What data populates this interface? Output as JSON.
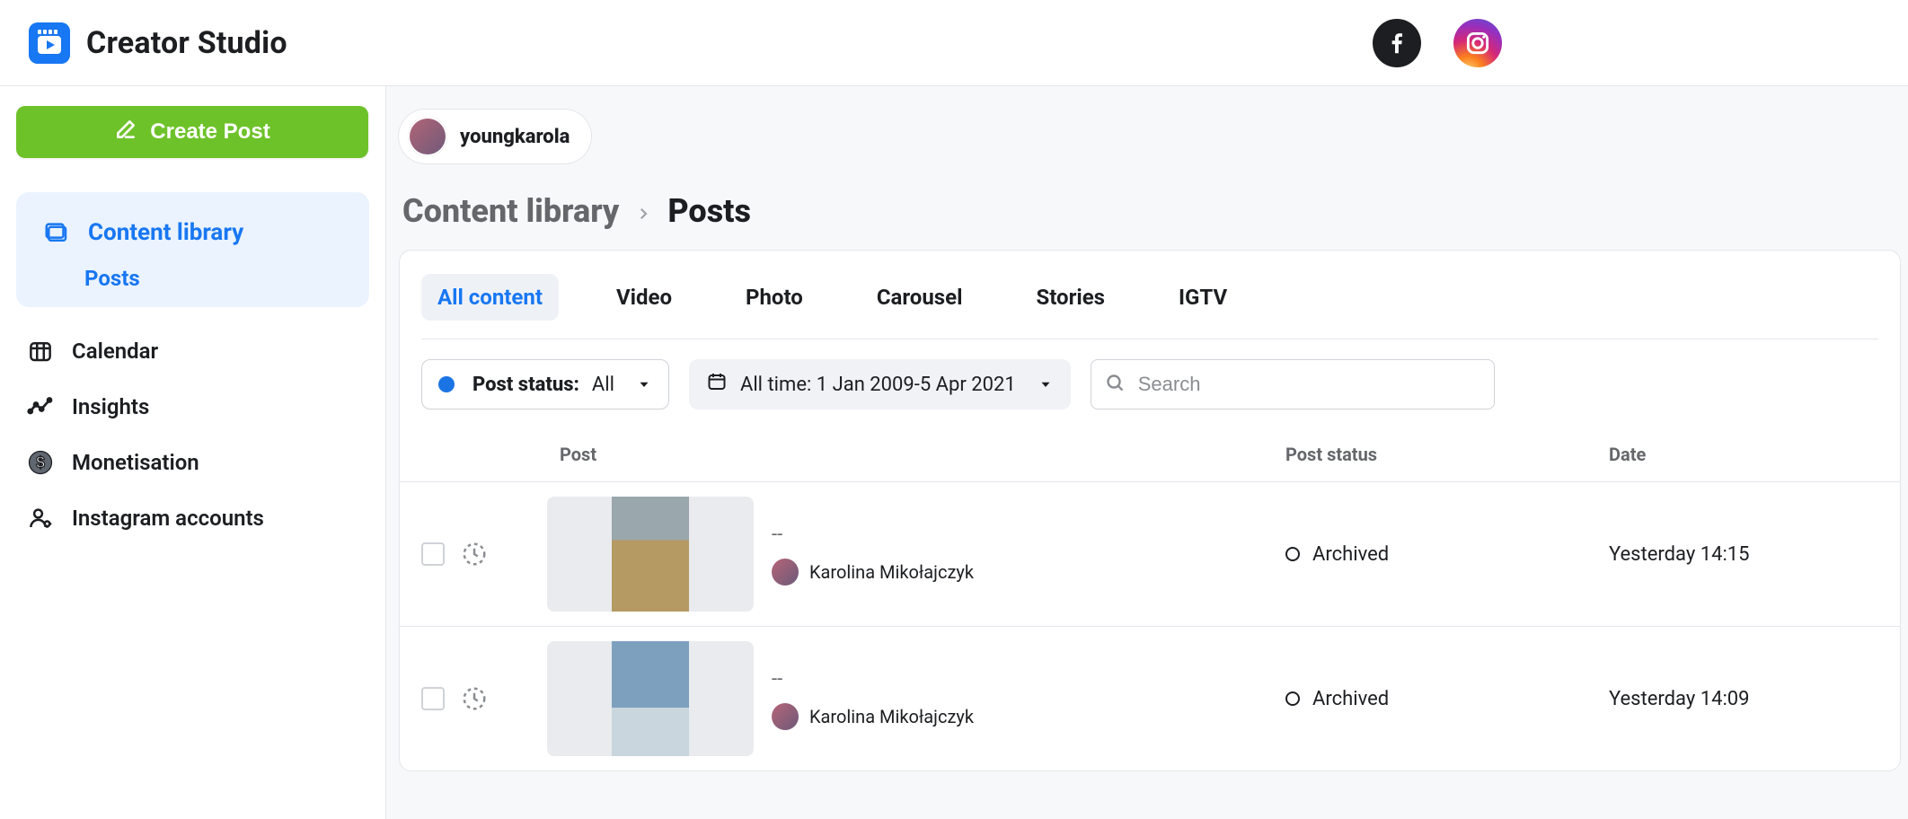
{
  "app": {
    "title": "Creator Studio"
  },
  "header": {
    "networks": {
      "fb_name": "facebook-icon",
      "ig_name": "instagram-icon"
    }
  },
  "sidebar": {
    "create_label": "Create Post",
    "items": [
      {
        "key": "content-library",
        "label": "Content library",
        "sub": {
          "label": "Posts"
        }
      },
      {
        "key": "calendar",
        "label": "Calendar"
      },
      {
        "key": "insights",
        "label": "Insights"
      },
      {
        "key": "monetisation",
        "label": "Monetisation"
      },
      {
        "key": "instagram-accounts",
        "label": "Instagram accounts"
      }
    ]
  },
  "account": {
    "username": "youngkarola"
  },
  "breadcrumb": {
    "root": "Content library",
    "current": "Posts"
  },
  "tabs": [
    {
      "key": "all",
      "label": "All content",
      "active": true
    },
    {
      "key": "video",
      "label": "Video"
    },
    {
      "key": "photo",
      "label": "Photo"
    },
    {
      "key": "carousel",
      "label": "Carousel"
    },
    {
      "key": "stories",
      "label": "Stories"
    },
    {
      "key": "igtv",
      "label": "IGTV"
    }
  ],
  "filters": {
    "post_status_label": "Post status:",
    "post_status_value": "All",
    "date_label": "All time: 1 Jan 2009-5 Apr 2021",
    "search_placeholder": "Search"
  },
  "table": {
    "columns": {
      "post": "Post",
      "status": "Post status",
      "date": "Date"
    },
    "rows": [
      {
        "title": "--",
        "author": "Karolina Mikołajczyk",
        "status": "Archived",
        "date": "Yesterday 14:15",
        "thumb": "field"
      },
      {
        "title": "--",
        "author": "Karolina Mikołajczyk",
        "status": "Archived",
        "date": "Yesterday 14:09",
        "thumb": "sea"
      }
    ]
  }
}
